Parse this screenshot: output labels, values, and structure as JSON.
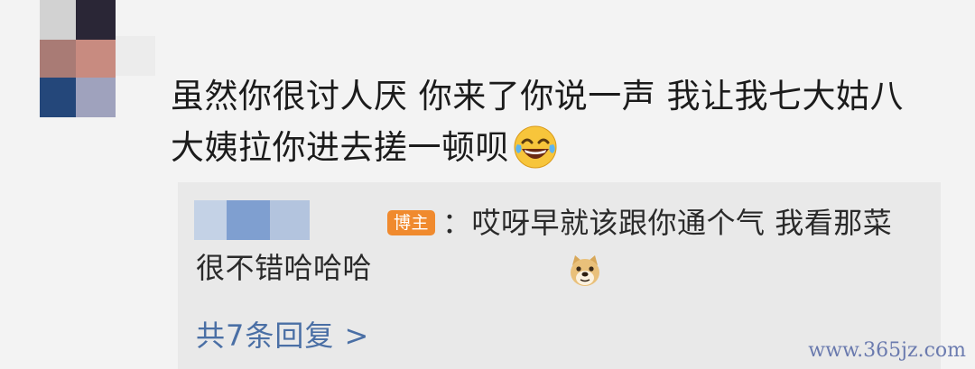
{
  "comment": {
    "text": "虽然你很讨人厌 你来了你说一声 我让我七大姑八大姨拉你进去搓一顿呗",
    "emoji": "laughing-tears-emoji"
  },
  "reply": {
    "badge": "博主",
    "separator": "：",
    "text": "哎呀早就该跟你通个气 我看那菜很不错哈哈哈",
    "emoji": "doge-emoji",
    "more_label": "共7条回复 >"
  },
  "watermark": "www.365jz.com",
  "colors": {
    "background": "#f3f3f3",
    "reply_background": "#e9e9e9",
    "badge": "#f08a2e",
    "link": "#4a6fa5"
  }
}
